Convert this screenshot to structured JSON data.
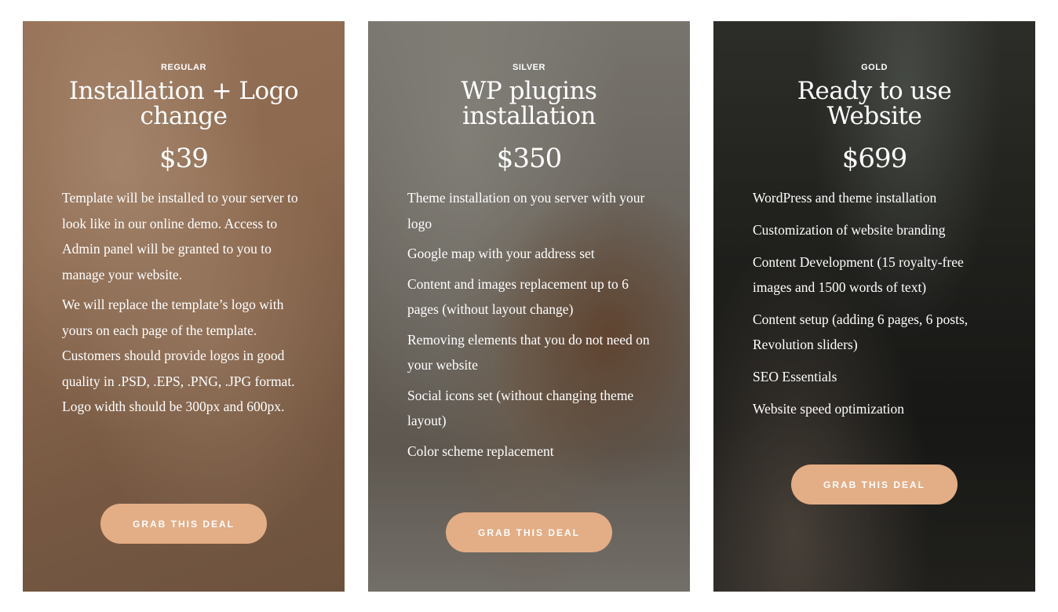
{
  "plans": [
    {
      "tier": "REGULAR",
      "title": "Installation + Logo change",
      "price": "$39",
      "features": [
        "Template will be installed to your server to look like in our online demo. Access to Admin panel will be granted to you to manage your website.",
        "We will replace the template’s logo with yours on each page of the template. Customers should provide logos in good quality in .PSD, .EPS, .PNG, .JPG format. Logo width should be 300px and 600px."
      ],
      "cta_label": "GRAB THIS DEAL"
    },
    {
      "tier": "SILVER",
      "title": "WP plugins installation",
      "price": "$350",
      "features": [
        "Theme installation on you server with your logo",
        "Google map with your address set",
        "Content and images replacement up to 6 pages (without layout change)",
        "Removing elements that you do not need on your website",
        "Social icons set (without changing theme layout)",
        "Color scheme replacement"
      ],
      "cta_label": "GRAB THIS DEAL"
    },
    {
      "tier": "GOLD",
      "title": "Ready to use Website",
      "price": "$699",
      "features": [
        "WordPress and theme installation",
        "Customization of website branding",
        "Content Development (15 royalty-free images and 1500 words of text)",
        "Content setup (adding 6 pages, 6 posts, Revolution sliders)",
        "SEO Essentials",
        "Website speed optimization"
      ],
      "cta_label": "GRAB THIS DEAL"
    }
  ],
  "colors": {
    "cta_background": "#e3ad85",
    "text": "#ffffff"
  }
}
